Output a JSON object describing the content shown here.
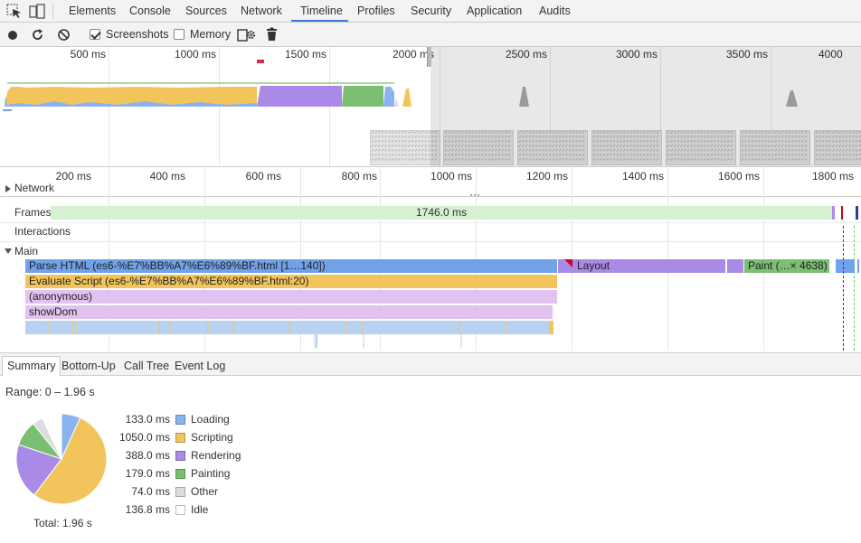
{
  "colors": {
    "loading": "#8ab4ef",
    "scripting": "#f2c55c",
    "rendering": "#a98ae6",
    "painting": "#7bbf72",
    "other": "#dddddd",
    "idle": "#ffffff",
    "accent": "#3879d9"
  },
  "icons": {
    "inspect": "inspect-element-icon",
    "device": "device-toolbar-icon",
    "record": "record-icon",
    "reload": "reload-icon",
    "clear": "clear-icon",
    "settings": "capture-settings-icon",
    "gc": "collect-garbage-icon"
  },
  "tabs": [
    "Elements",
    "Console",
    "Sources",
    "Network",
    "Timeline",
    "Profiles",
    "Security",
    "Application",
    "Audits"
  ],
  "active_tab": "Timeline",
  "toolbar": {
    "screenshots_label": "Screenshots",
    "screenshots_checked": true,
    "memory_label": "Memory",
    "memory_checked": false
  },
  "overview": {
    "ticks": [
      "500 ms",
      "1000 ms",
      "1500 ms",
      "2000 ms",
      "2500 ms",
      "3000 ms",
      "3500 ms",
      "4000"
    ]
  },
  "flame": {
    "ticks": [
      "200 ms",
      "400 ms",
      "600 ms",
      "800 ms",
      "1000 ms",
      "1200 ms",
      "1400 ms",
      "1600 ms",
      "1800 ms"
    ],
    "network_label": "Network",
    "frames_label": "Frames",
    "frame_duration": "1746.0 ms",
    "interactions_label": "Interactions",
    "main_label": "Main",
    "parse_html": "Parse HTML (es6-%E7%BB%A7%E6%89%BF.html [1…140])",
    "layout": "Layout",
    "paint": "Paint (…× 4638)",
    "evaluate_script": "Evaluate Script (es6-%E7%BB%A7%E6%89%BF.html:20)",
    "anonymous": "(anonymous)",
    "showdom": "showDom"
  },
  "bottom_tabs": [
    "Summary",
    "Bottom-Up",
    "Call Tree",
    "Event Log"
  ],
  "active_bottom_tab": "Summary",
  "summary": {
    "range": "Range: 0 – 1.96 s",
    "total": "Total: 1.96 s",
    "categories": [
      {
        "value": "133.0 ms",
        "name": "Loading",
        "ms": 133.0
      },
      {
        "value": "1050.0 ms",
        "name": "Scripting",
        "ms": 1050.0
      },
      {
        "value": "388.0 ms",
        "name": "Rendering",
        "ms": 388.0
      },
      {
        "value": "179.0 ms",
        "name": "Painting",
        "ms": 179.0
      },
      {
        "value": "74.0 ms",
        "name": "Other",
        "ms": 74.0
      },
      {
        "value": "136.8 ms",
        "name": "Idle",
        "ms": 136.8
      }
    ]
  }
}
